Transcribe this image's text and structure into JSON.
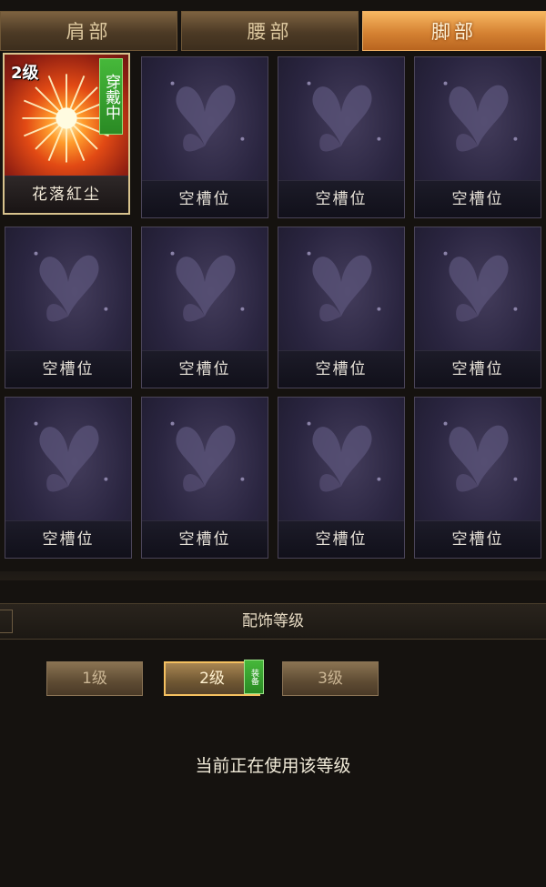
{
  "tabs": [
    {
      "label": "肩部",
      "active": false
    },
    {
      "label": "腰部",
      "active": false
    },
    {
      "label": "脚部",
      "active": true
    }
  ],
  "slots": [
    {
      "name": "花落紅尘",
      "equipped": true,
      "level_tag": "2级",
      "wear_tag": "穿戴中",
      "icon": "sun-burst-icon"
    },
    {
      "name": "空槽位",
      "icon": "butterfly-icon"
    },
    {
      "name": "空槽位",
      "icon": "butterfly-icon"
    },
    {
      "name": "空槽位",
      "icon": "butterfly-icon"
    },
    {
      "name": "空槽位",
      "icon": "butterfly-icon"
    },
    {
      "name": "空槽位",
      "icon": "butterfly-icon"
    },
    {
      "name": "空槽位",
      "icon": "butterfly-icon"
    },
    {
      "name": "空槽位",
      "icon": "butterfly-icon"
    },
    {
      "name": "空槽位",
      "icon": "butterfly-icon"
    },
    {
      "name": "空槽位",
      "icon": "butterfly-icon"
    },
    {
      "name": "空槽位",
      "icon": "butterfly-icon"
    },
    {
      "name": "空槽位",
      "icon": "butterfly-icon"
    }
  ],
  "level_section": {
    "title": "配饰等级",
    "levels": [
      {
        "label": "1级",
        "active": false
      },
      {
        "label": "2级",
        "active": true
      },
      {
        "label": "3级",
        "active": false
      }
    ],
    "equip_badge": "装备",
    "status_text": "当前正在使用该等级"
  },
  "colors": {
    "accent": "#d58233",
    "wear_green": "#2a8a24",
    "panel_bg": "#15120f",
    "slot_bg": "#2a2540"
  }
}
